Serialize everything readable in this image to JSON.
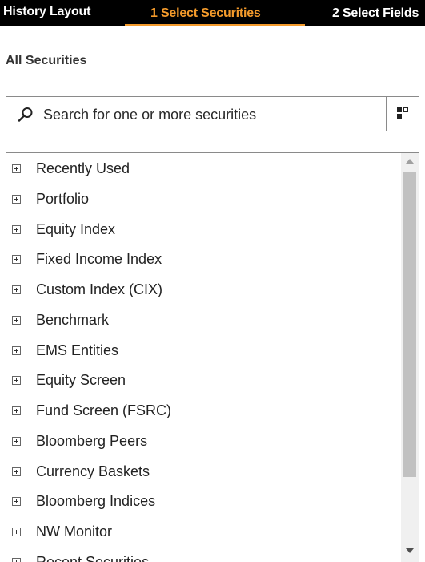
{
  "topbar": {
    "title": "History Layout",
    "tabs": [
      {
        "label": "1 Select Securities",
        "active": true
      },
      {
        "label": "2 Select Fields",
        "active": false
      }
    ]
  },
  "section_title": "All Securities",
  "search": {
    "placeholder": "Search for one or more securities",
    "icon": "magnifier-icon",
    "browse_icon": "browse-grid-icon"
  },
  "tree": {
    "items": [
      "Recently Used",
      "Portfolio",
      "Equity Index",
      "Fixed Income Index",
      "Custom Index (CIX)",
      "Benchmark",
      "EMS Entities",
      "Equity Screen",
      "Fund Screen (FSRC)",
      "Bloomberg Peers",
      "Currency Baskets",
      "Bloomberg Indices",
      "NW Monitor",
      "Recent Securities"
    ]
  },
  "colors": {
    "accent": "#f39a2b",
    "topbar_bg": "#000000"
  }
}
